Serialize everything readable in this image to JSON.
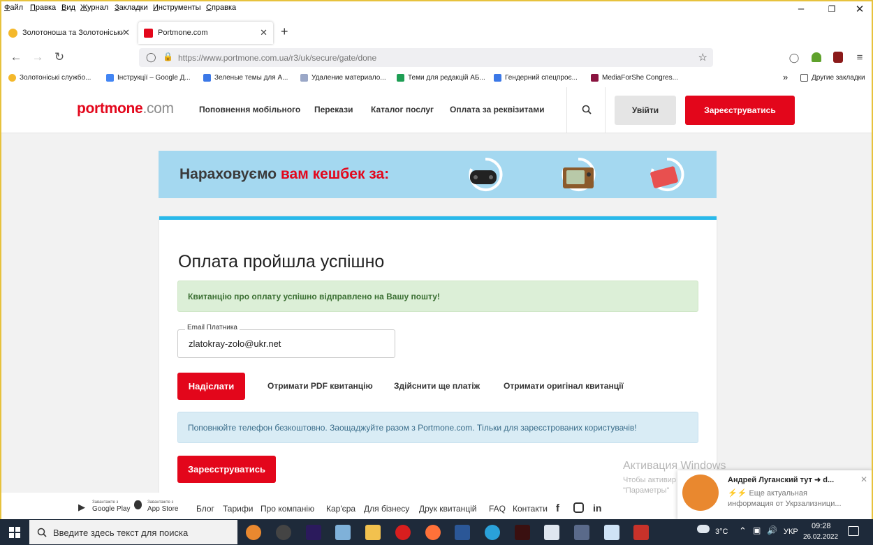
{
  "menubar": {
    "items": [
      "Файл",
      "Правка",
      "Вид",
      "Журнал",
      "Закладки",
      "Инструменты",
      "Справка"
    ]
  },
  "tabs": [
    {
      "title": "Золотоноша та Золотоніськи",
      "icon": "yellow-circle-favicon"
    },
    {
      "title": "Portmone.com",
      "icon": "portmone-favicon",
      "active": true
    }
  ],
  "address": {
    "url": "https://www.portmone.com.ua/r3/uk/secure/gate/done"
  },
  "bookmarks": {
    "items": [
      "Золотоніські службо...",
      "Інструкції – Google Д...",
      "Зеленые темы для А...",
      "Удаление материало...",
      "Теми для редакцій АБ...",
      "Гендерний спецпроє...",
      "MediaForShe Congres..."
    ],
    "other": "Другие закладки"
  },
  "site": {
    "logo_main": "portmone",
    "logo_domain": ".com",
    "nav": [
      "Поповнення мобільного",
      "Перекази",
      "Каталог послуг",
      "Оплата за реквізитами"
    ],
    "login": "Увійти",
    "register": "Зареєструватись"
  },
  "banner": {
    "text_plain": "Нараховуємо ",
    "text_accent": "вам кешбек за:",
    "icons": [
      "gamepad-icon",
      "tv-icon",
      "credit-card-icon"
    ]
  },
  "main": {
    "title": "Оплата пройшла успішно",
    "success_msg": "Квитанцію про оплату успішно відправлено на Вашу пошту!",
    "email_label": "Email Платника",
    "email_value": "zlatokray-zolo@ukr.net",
    "send_button": "Надіслати",
    "links": [
      "Отримати PDF квитанцію",
      "Здійснити ще платіж",
      "Отримати оригінал квитанції"
    ],
    "info_msg": "Поповнюйте телефон безкоштовно. Заощаджуйте разом з Portmone.com. Тільки для зареєстрованих користувачів!",
    "register_button": "Зареєструватись"
  },
  "footer": {
    "google_play_small": "Завантажте з",
    "google_play": "Google Play",
    "app_store_small": "Завантажте з",
    "app_store": "App Store",
    "links": [
      "Блог",
      "Тарифи",
      "Про компанію",
      "Кар'єра",
      "Для бізнесу",
      "Друк квитанцій",
      "FAQ",
      "Контакти"
    ],
    "social": [
      "facebook-icon",
      "instagram-icon",
      "linkedin-icon"
    ]
  },
  "windows_activation": {
    "title": "Активация Windows",
    "line1": "Чтобы активир",
    "line2": "\"Параметры\""
  },
  "notification": {
    "title": "Андрей Луганский тут ➜ d...",
    "body": "⚡⚡ Еще актуальная информация от Укрзализници..."
  },
  "taskbar": {
    "search_placeholder": "Введите здесь текст для поиска",
    "weather": "3°C",
    "lang": "УКР",
    "time": "09:28",
    "date": "26.02.2022"
  }
}
